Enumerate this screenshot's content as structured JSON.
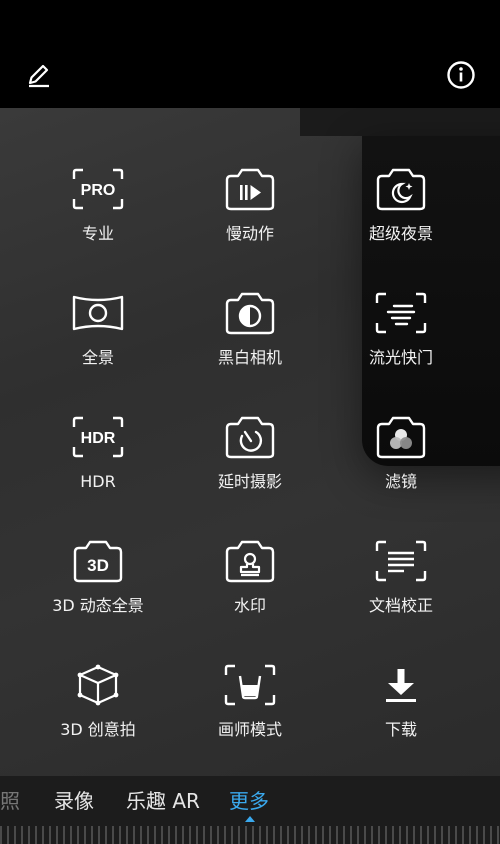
{
  "top_bar": {
    "edit_icon": "edit-pencil-icon",
    "info_icon": "info-circle-icon"
  },
  "modes": [
    {
      "label": "专业",
      "icon": "pro-mode-icon",
      "badge": "PRO"
    },
    {
      "label": "慢动作",
      "icon": "slow-motion-icon"
    },
    {
      "label": "超级夜景",
      "icon": "night-mode-icon"
    },
    {
      "label": "全景",
      "icon": "panorama-icon"
    },
    {
      "label": "黑白相机",
      "icon": "monochrome-camera-icon"
    },
    {
      "label": "流光快门",
      "icon": "light-painting-icon"
    },
    {
      "label": "HDR",
      "icon": "hdr-icon",
      "badge": "HDR"
    },
    {
      "label": "延时摄影",
      "icon": "time-lapse-icon"
    },
    {
      "label": "滤镜",
      "icon": "filter-icon"
    },
    {
      "label": "3D 动态全景",
      "icon": "3d-panorama-icon",
      "badge": "3D"
    },
    {
      "label": "水印",
      "icon": "watermark-icon"
    },
    {
      "label": "文档校正",
      "icon": "document-scan-icon"
    },
    {
      "label": "3D 创意拍",
      "icon": "3d-creative-icon"
    },
    {
      "label": "画师模式",
      "icon": "artist-mode-icon"
    },
    {
      "label": "下载",
      "icon": "download-icon"
    }
  ],
  "mode_bar": {
    "tabs": [
      {
        "label": "照",
        "state": "faded"
      },
      {
        "label": "录像",
        "state": "normal"
      },
      {
        "label": "乐趣 AR",
        "state": "normal"
      },
      {
        "label": "更多",
        "state": "active"
      }
    ]
  },
  "colors": {
    "accent": "#3aa9ee",
    "icon": "#ffffff",
    "label": "#f2f2f2",
    "bar_bg": "#1c1c1c"
  }
}
